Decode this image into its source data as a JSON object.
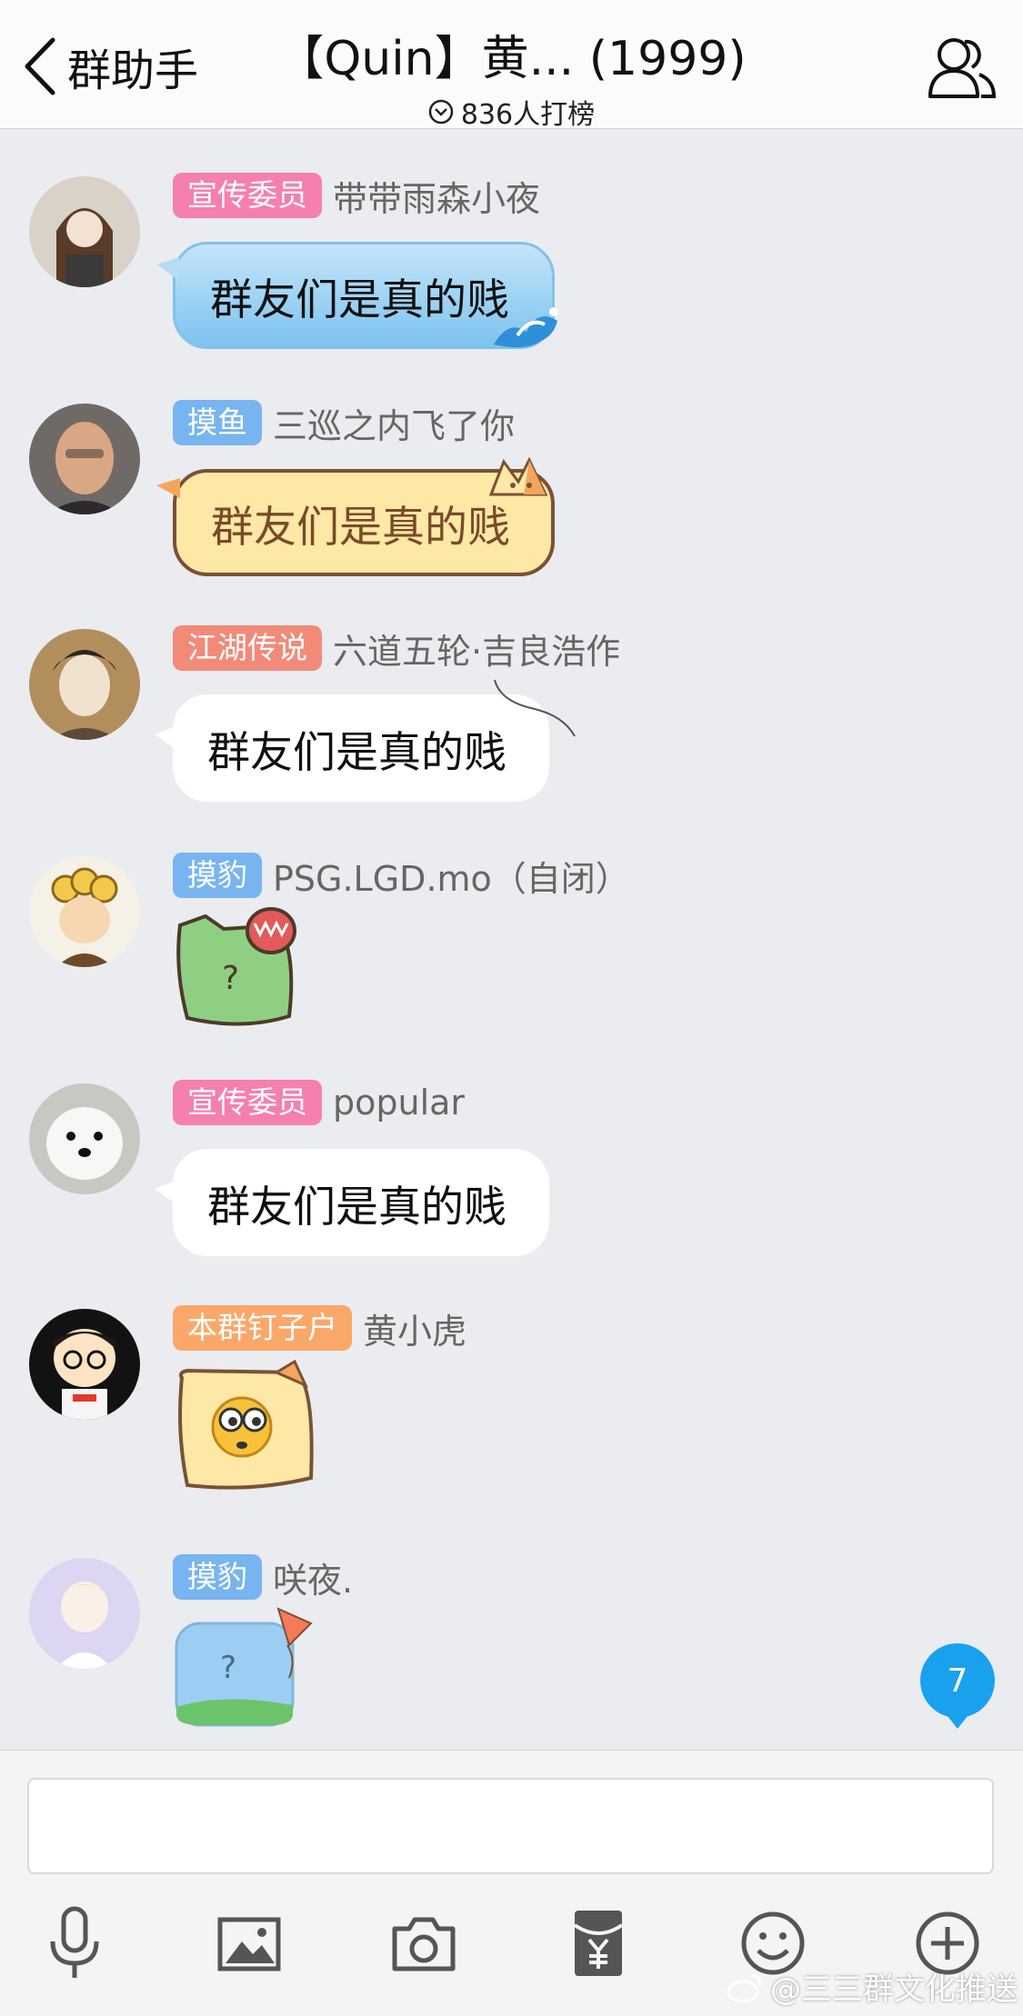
{
  "header": {
    "back_label": "群助手",
    "title": "【Quin】黄... (1999)",
    "subtitle": "836人打榜"
  },
  "messages": [
    {
      "badge": "宣传委员",
      "badge_color": "#f57fb0",
      "nick": "带带雨森小夜",
      "text": "群友们是真的贱",
      "bubble": "blue"
    },
    {
      "badge": "摸鱼",
      "badge_color": "#78b4f0",
      "nick": "三巡之内飞了你",
      "text": "群友们是真的贱",
      "bubble": "cat"
    },
    {
      "badge": "江湖传说",
      "badge_color": "#f28a78",
      "nick": "六道五轮·吉良浩作",
      "text": "群友们是真的贱",
      "bubble": "white"
    },
    {
      "badge": "摸豹",
      "badge_color": "#78b4f0",
      "nick": "PSG.LGD.mo（自闭）",
      "sticker_text": "?"
    },
    {
      "badge": "宣传委员",
      "badge_color": "#f57fb0",
      "nick": "popular",
      "text": "群友们是真的贱",
      "bubble": "white"
    },
    {
      "badge": "本群钉子户",
      "badge_color": "#f9a86a",
      "nick": "黄小虎"
    },
    {
      "badge": "摸豹",
      "badge_color": "#78b4f0",
      "nick": "咲夜.",
      "sticker_text": "?"
    }
  ],
  "unread_count": "7",
  "input": {
    "placeholder": ""
  },
  "toolbar_icons": [
    "microphone-icon",
    "image-icon",
    "camera-icon",
    "red-packet-icon",
    "emoji-icon",
    "plus-icon"
  ],
  "watermark": "@三三群文化推送",
  "colors": {
    "accent": "#1aa1ee",
    "background": "#eaecf0",
    "header": "#fbfbfb"
  }
}
